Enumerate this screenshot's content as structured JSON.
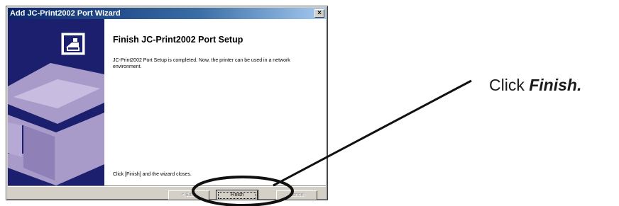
{
  "dialog": {
    "title": "Add JC-Print2002 Port Wizard",
    "close_glyph": "×",
    "heading": "Finish JC-Print2002 Port Setup",
    "description": "JC-Print2002 Port Setup is completed. Now, the printer can be used in a network environment.",
    "closing_note": "Click [Finish] and the wizard closes.",
    "buttons": {
      "back": "< Back",
      "finish": "Finish",
      "cancel": "Cancel"
    }
  },
  "annotation": {
    "prefix": "Click ",
    "target": "Finish."
  },
  "colors": {
    "side_panel": "#1c1e6e",
    "printer_graphic": "#a89bc9",
    "callout_ring": "#111111"
  },
  "icons": [
    "wizard-printer-icon",
    "printer-illustration"
  ]
}
